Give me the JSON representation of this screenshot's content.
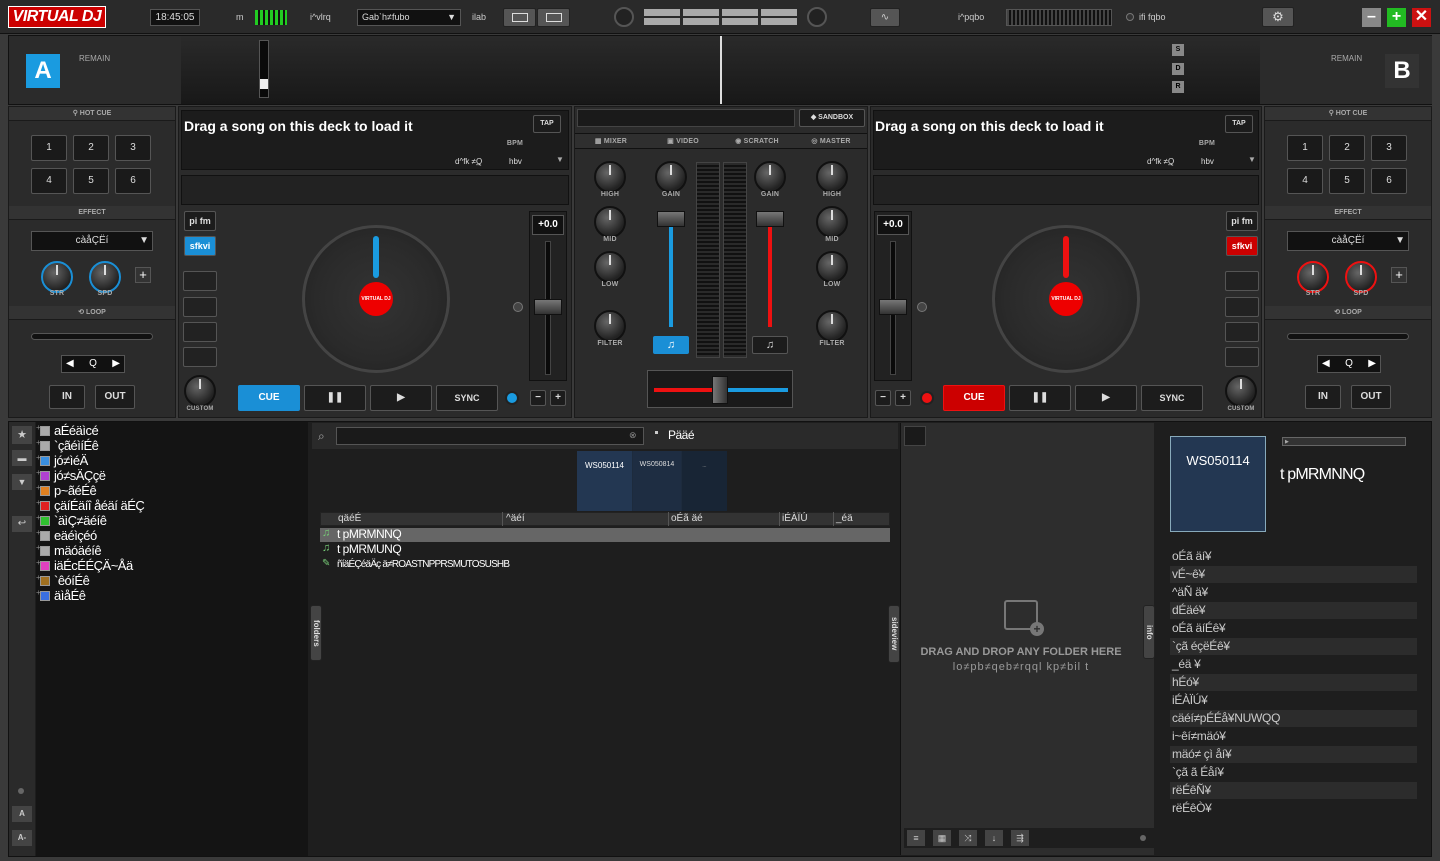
{
  "app": {
    "logo": "VIRTUAL DJ",
    "clock": "18:45:05"
  },
  "topbar": {
    "master_label": "m",
    "layout_label": "i^vlrq",
    "skin_value": "Gabˋh≠fubo",
    "lab_label": "ilab",
    "rec_label": "i^pqbo",
    "fx_label": "ifi fqbo"
  },
  "decks": {
    "left": {
      "letter": "A",
      "remain": "REMAIN",
      "hot_cue": "HOT CUE",
      "pads": [
        "1",
        "2",
        "3",
        "4",
        "5",
        "6"
      ],
      "effect_header": "EFFECT",
      "effect_value": "càåÇËí",
      "knob1": "STR",
      "knob2": "SPD",
      "loop_header": "LOOP",
      "loop_value": "Q",
      "in": "IN",
      "out": "OUT",
      "load_text": "Drag a song on this deck to load it",
      "tap": "TAP",
      "bpm": "BPM",
      "key_label": "d^fk ≠Q̲",
      "key_value": "hbv",
      "pitch": "+0.0",
      "custom": "CUSTOM",
      "btn1": "pi fm",
      "btn2": "sfkvi",
      "cue": "CUE",
      "sync": "SYNC",
      "accent": "#1a8fd6"
    },
    "right": {
      "letter": "B",
      "remain": "REMAIN",
      "hot_cue": "HOT CUE",
      "pads": [
        "1",
        "2",
        "3",
        "4",
        "5",
        "6"
      ],
      "effect_header": "EFFECT",
      "effect_value": "càåÇËí",
      "knob1": "STR",
      "knob2": "SPD",
      "loop_header": "LOOP",
      "loop_value": "Q",
      "in": "IN",
      "out": "OUT",
      "load_text": "Drag a song on this deck to load it",
      "tap": "TAP",
      "bpm": "BPM",
      "key_label": "d^fk ≠Q̲",
      "key_value": "hbv",
      "pitch": "+0.0",
      "custom": "CUSTOM",
      "btn1": "pi fm",
      "btn2": "sfkvi",
      "cue": "CUE",
      "sync": "SYNC",
      "accent": "#e11"
    }
  },
  "mixer": {
    "sandbox": "SANDBOX",
    "tabs": [
      "MIXER",
      "VIDEO",
      "SCRATCH",
      "MASTER"
    ],
    "high": "HIGH",
    "mid": "MID",
    "low": "LOW",
    "filter": "FILTER",
    "gain": "GAIN"
  },
  "waveform_side_buttons": [
    "S",
    "D",
    "R"
  ],
  "browser": {
    "tree": [
      {
        "label": "aÉéäìcé",
        "color": "#aaa"
      },
      {
        "label": "`çãéìíÉê",
        "color": "#aaa"
      },
      {
        "label": "jó≠ìéÄ",
        "color": "#3a8fe0"
      },
      {
        "label": "jó≠sÄÇçë",
        "color": "#b040d0"
      },
      {
        "label": "p~ãéÉê",
        "color": "#e08020"
      },
      {
        "label": "çäíÉäíî åéäí äÉÇ",
        "color": "#e02020"
      },
      {
        "label": "`äìÇ≠äéíê",
        "color": "#30c030"
      },
      {
        "label": "eäéìçéó",
        "color": "#aaa"
      },
      {
        "label": "mäóäéíê",
        "color": "#aaa"
      },
      {
        "label": "iäÉcÉÉÇÄ~Åä",
        "color": "#e040c0"
      },
      {
        "label": "`êóíÉê",
        "color": "#a07020"
      },
      {
        "label": "äìåÉê",
        "color": "#3a6fe0"
      }
    ],
    "search_placeholder": "",
    "search_context": "Pääé",
    "covers": [
      "WS050114",
      "WS050814",
      "..."
    ],
    "columns": [
      "qäéÉ",
      "^äéí",
      "oÉã äé",
      "iÉÀÏÚ",
      "_éä"
    ],
    "rows": [
      {
        "title": "t pMRMNNQ",
        "icon": "music-note-icon"
      },
      {
        "title": "t pMRMUNQ",
        "icon": "music-note-icon"
      },
      {
        "title": "ñíäÉÇéäÄç ä≠ROASTNPPRSMUTOSUSHB",
        "icon": "file-icon"
      }
    ],
    "folders_tab": "folders",
    "sideview_tab": "sideview",
    "info_tab": "info",
    "drop_title": "DRAG AND DROP ANY FOLDER HERE",
    "drop_sub": "lo≠pb≠qeb≠rqql kp≠bil t",
    "side_buttons": [
      "A",
      "A-"
    ]
  },
  "info": {
    "cover": "WS050114",
    "title": "t pMRMNNQ",
    "rows": [
      "oÉã äí¥",
      "vÉ~ê¥",
      "^äÑ ä¥",
      "dÉäé¥",
      "oÉã äíÉê¥",
      "`çã éçëÉê¥",
      "_éä ¥",
      "hÉó¥",
      "iÉÀÏÚ¥",
      "cäéí≠pÉÉå¥NUWQQ",
      "i~êí≠mäó¥",
      "mäó≠ çì åí¥",
      "`çã ã Éåí¥",
      "rëÉêÑ¥",
      "rëÉêÒ¥"
    ]
  }
}
